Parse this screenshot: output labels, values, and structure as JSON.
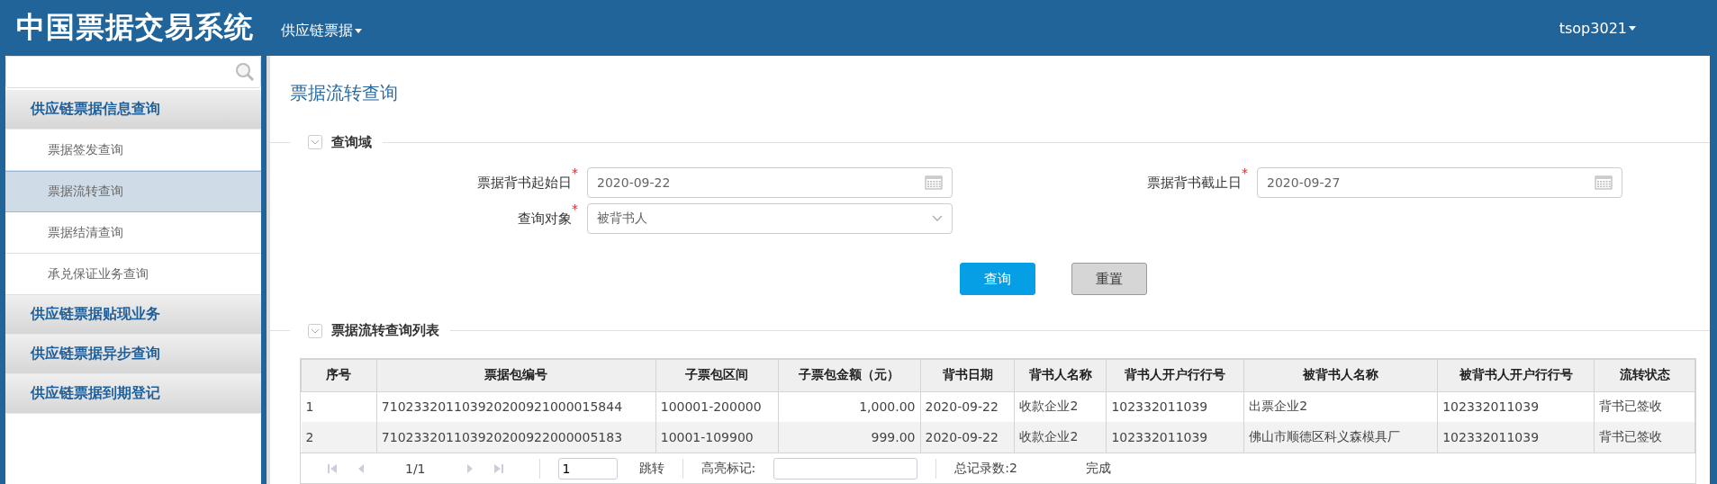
{
  "header": {
    "title": "中国票据交易系统",
    "menu": "供应链票据",
    "user": "tsop3021"
  },
  "sidebar": {
    "groups": [
      {
        "label": "供应链票据信息查询",
        "items": [
          {
            "label": "票据签发查询",
            "selected": false
          },
          {
            "label": "票据流转查询",
            "selected": true
          },
          {
            "label": "票据结清查询",
            "selected": false
          },
          {
            "label": "承兑保证业务查询",
            "selected": false
          }
        ]
      },
      {
        "label": "供应链票据贴现业务"
      },
      {
        "label": "供应链票据异步查询"
      },
      {
        "label": "供应链票据到期登记"
      }
    ]
  },
  "page_title": "票据流转查询",
  "query_section": {
    "title": "查询域",
    "fields": [
      {
        "kind": "date",
        "label": "票据背书起始日",
        "required_mark": "*",
        "value": "2020-09-22"
      },
      {
        "kind": "date",
        "label": "票据背书截止日",
        "required_mark": "*",
        "value": "2020-09-27"
      },
      {
        "kind": "select",
        "label": "查询对象",
        "required_mark": "*",
        "value": "被背书人"
      }
    ],
    "buttons": [
      {
        "label": "查询",
        "kind": "primary"
      },
      {
        "label": "重置",
        "kind": "secondary"
      }
    ]
  },
  "list_section": {
    "title": "票据流转查询列表",
    "table": {
      "columns": [
        "序号",
        "票据包编号",
        "子票包区间",
        "子票包金额（元）",
        "背书日期",
        "背书人名称",
        "背书人开户行行号",
        "被背书人名称",
        "被背书人开户行行号",
        "流转状态"
      ],
      "rows": [
        [
          "1",
          "710233201103920200921000015844",
          "100001-200000",
          "1,000.00",
          "2020-09-22",
          "收款企业2",
          "102332011039",
          "出票企业2",
          "102332011039",
          "背书已签收"
        ],
        [
          "2",
          "710233201103920200922000005183",
          "10001-109900",
          "999.00",
          "2020-09-22",
          "收款企业2",
          "102332011039",
          "佛山市顺德区科义森模具厂",
          "102332011039",
          "背书已签收"
        ]
      ]
    },
    "pager": {
      "page": "1/1",
      "page_input": "1",
      "jump": "跳转",
      "highlight_label": "高亮标记:",
      "total": "总记录数:2",
      "status": "完成"
    }
  }
}
